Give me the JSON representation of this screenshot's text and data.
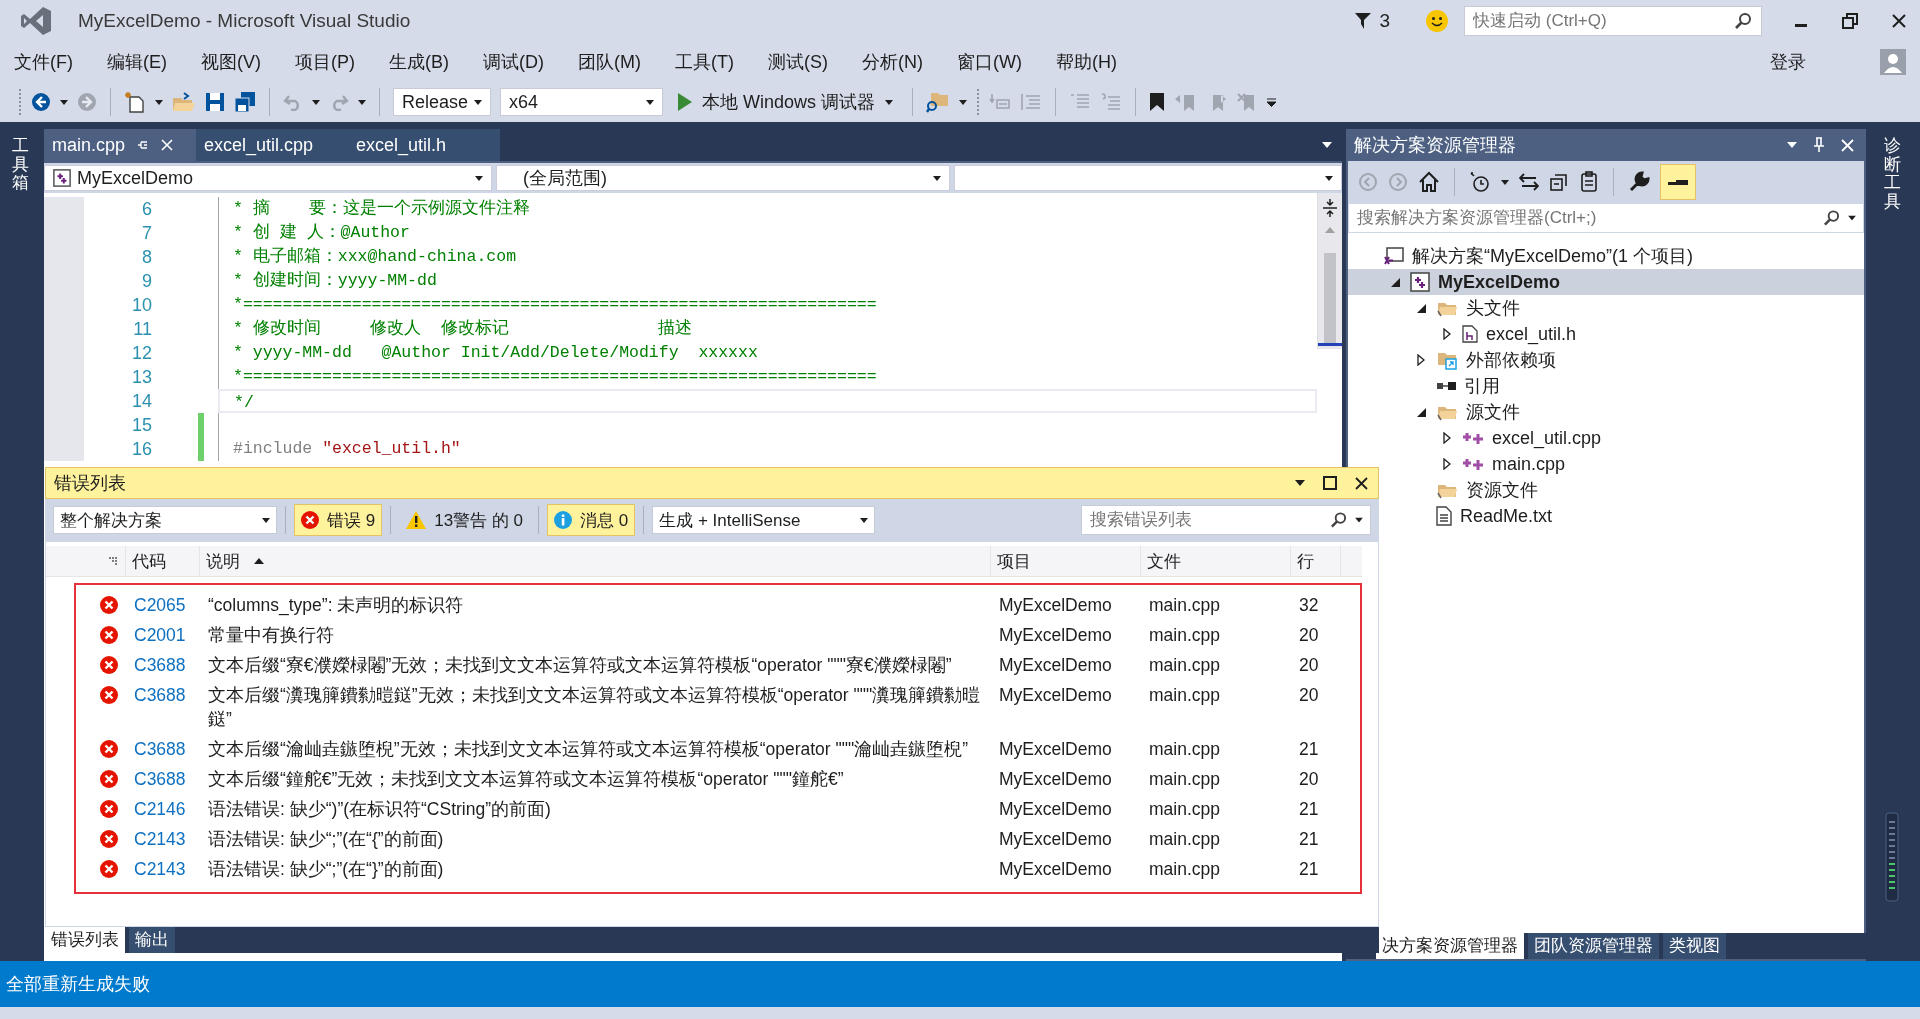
{
  "window": {
    "title": "MyExcelDemo - Microsoft Visual Studio",
    "notification_count": "3",
    "quick_launch": {
      "placeholder": "快速启动 (Ctrl+Q)"
    },
    "sign_in": "登录"
  },
  "menu": [
    "文件(F)",
    "编辑(E)",
    "视图(V)",
    "项目(P)",
    "生成(B)",
    "调试(D)",
    "团队(M)",
    "工具(T)",
    "测试(S)",
    "分析(N)",
    "窗口(W)",
    "帮助(H)"
  ],
  "toolbar": {
    "configuration": "Release",
    "platform": "x64",
    "debugger": "本地 Windows 调试器"
  },
  "left_rail": "工具箱",
  "right_rail": "诊断工具",
  "editor": {
    "tabs": [
      {
        "label": "main.cpp",
        "selected": true
      },
      {
        "label": "excel_util.cpp",
        "selected": false
      },
      {
        "label": "excel_util.h",
        "selected": false
      }
    ],
    "project": "MyExcelDemo",
    "scope": "(全局范围)",
    "lines": [
      {
        "number": "6",
        "current": false,
        "changed": false,
        "parts": [
          {
            "kind": "comment",
            "text": "* 摘    要：这是一个示例源文件注释"
          }
        ]
      },
      {
        "number": "7",
        "current": false,
        "changed": false,
        "parts": [
          {
            "kind": "comment",
            "text": "* 创 建 人：@Author"
          }
        ]
      },
      {
        "number": "8",
        "current": false,
        "changed": false,
        "parts": [
          {
            "kind": "comment",
            "text": "* 电子邮箱：xxx@hand-china.com"
          }
        ]
      },
      {
        "number": "9",
        "current": false,
        "changed": false,
        "parts": [
          {
            "kind": "comment",
            "text": "* 创建时间：yyyy-MM-dd"
          }
        ]
      },
      {
        "number": "10",
        "current": false,
        "changed": false,
        "parts": [
          {
            "kind": "comment",
            "text": "*================================================================"
          }
        ]
      },
      {
        "number": "11",
        "current": false,
        "changed": false,
        "parts": [
          {
            "kind": "comment",
            "text": "* 修改时间     修改人  修改标记               描述"
          }
        ]
      },
      {
        "number": "12",
        "current": false,
        "changed": false,
        "parts": [
          {
            "kind": "comment",
            "text": "* yyyy-MM-dd   @Author Init/Add/Delete/Modify  xxxxxx"
          }
        ]
      },
      {
        "number": "13",
        "current": false,
        "changed": false,
        "parts": [
          {
            "kind": "comment",
            "text": "*================================================================"
          }
        ]
      },
      {
        "number": "14",
        "current": true,
        "changed": false,
        "parts": [
          {
            "kind": "comment",
            "text": "*/"
          }
        ]
      },
      {
        "number": "15",
        "current": false,
        "changed": true
      },
      {
        "number": "16",
        "current": false,
        "changed": true,
        "parts": [
          {
            "kind": "directive",
            "text": "#include "
          },
          {
            "kind": "string",
            "text": "\"excel_util.h\""
          }
        ]
      }
    ]
  },
  "error_list": {
    "title": "错误列表",
    "scope": "整个解决方案",
    "filters": [
      {
        "kind": "error",
        "label": "错误 9",
        "selected": true
      },
      {
        "kind": "warning",
        "label": "13警告 的 0",
        "selected": false
      },
      {
        "kind": "message",
        "label": "消息 0",
        "selected": true
      }
    ],
    "source": "生成 + IntelliSense",
    "search": {
      "placeholder": "搜索错误列表"
    },
    "columns": [
      "代码",
      "说明",
      "项目",
      "文件",
      "行"
    ],
    "rows": [
      {
        "code": "C2065",
        "description": "“columns_type”: 未声明的标识符",
        "project": "MyExcelDemo",
        "file": "main.cpp",
        "line": "32"
      },
      {
        "code": "C2001",
        "description": "常量中有换行符",
        "project": "MyExcelDemo",
        "file": "main.cpp",
        "line": "20"
      },
      {
        "code": "C3688",
        "description": "文本后缀“寮€濮嬫椂闂”无效；未找到文文本运算符或文本运算符模板“operator \"\"\"寮€濮嬫椂闂”",
        "project": "MyExcelDemo",
        "file": "main.cpp",
        "line": "20"
      },
      {
        "code": "C3688",
        "description": "文本后缀“瀵瑰簲鐨勬暟鎹”无效；未找到文文本运算符或文本运算符模板“operator \"\"\"瀵瑰簲鐨勬暟鎹”",
        "project": "MyExcelDemo",
        "file": "main.cpp",
        "line": "20"
      },
      {
        "code": "C3688",
        "description": "文本后缀“瀹屾垚鏃堕棿”无效；未找到文文本运算符或文本运算符模板“operator \"\"\"瀹屾垚鏃堕棿”",
        "project": "MyExcelDemo",
        "file": "main.cpp",
        "line": "21"
      },
      {
        "code": "C3688",
        "description": "文本后缀“鐘舵€”无效；未找到文文本运算符或文本运算符模板“operator \"\"\"鐘舵€”",
        "project": "MyExcelDemo",
        "file": "main.cpp",
        "line": "20"
      },
      {
        "code": "C2146",
        "description": "语法错误: 缺少“)”(在标识符“CString”的前面)",
        "project": "MyExcelDemo",
        "file": "main.cpp",
        "line": "21"
      },
      {
        "code": "C2143",
        "description": "语法错误: 缺少“;”(在“{”的前面)",
        "project": "MyExcelDemo",
        "file": "main.cpp",
        "line": "21"
      },
      {
        "code": "C2143",
        "description": "语法错误: 缺少“;”(在“}”的前面)",
        "project": "MyExcelDemo",
        "file": "main.cpp",
        "line": "21"
      }
    ],
    "tabs": [
      {
        "label": "错误列表",
        "selected": true
      },
      {
        "label": "输出",
        "selected": false
      }
    ]
  },
  "solution_explorer": {
    "title": "解决方案资源管理器",
    "search": {
      "placeholder": "搜索解决方案资源管理器(Ctrl+;)"
    },
    "tree": [
      {
        "label": "解决方案“MyExcelDemo”(1 个项目)",
        "kind": "solution",
        "selected": false,
        "children": [
          {
            "label": "MyExcelDemo",
            "kind": "project",
            "expanded": true,
            "selected": true,
            "children": [
              {
                "label": "头文件",
                "kind": "folder",
                "expanded": true,
                "selected": false,
                "children": [
                  {
                    "label": "excel_util.h",
                    "kind": "header",
                    "expanded": false,
                    "selected": false
                  }
                ]
              },
              {
                "label": "外部依赖项",
                "kind": "deps",
                "expanded": false,
                "selected": false
              },
              {
                "label": "引用",
                "kind": "refs",
                "selected": false
              },
              {
                "label": "源文件",
                "kind": "folder",
                "expanded": true,
                "selected": false,
                "children": [
                  {
                    "label": "excel_util.cpp",
                    "kind": "cpp",
                    "expanded": false,
                    "selected": false
                  },
                  {
                    "label": "main.cpp",
                    "kind": "cpp",
                    "expanded": false,
                    "selected": false
                  }
                ]
              },
              {
                "label": "资源文件",
                "kind": "folder",
                "selected": false
              },
              {
                "label": "ReadMe.txt",
                "kind": "text",
                "selected": false
              }
            ]
          }
        ]
      }
    ],
    "tabs": [
      {
        "label": "决方案资源管理器",
        "selected": true
      },
      {
        "label": "团队资源管理器",
        "selected": false
      },
      {
        "label": "类视图",
        "selected": false
      }
    ]
  },
  "status_bar": {
    "message": "全部重新生成失败"
  }
}
